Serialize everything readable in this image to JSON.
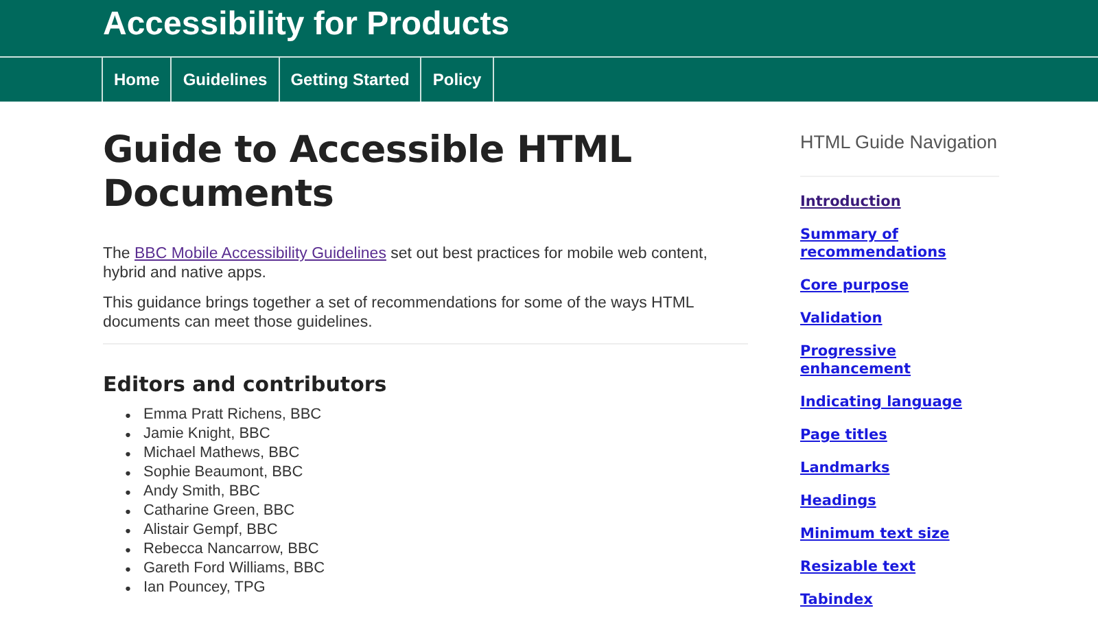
{
  "site_title": "Accessibility for Products",
  "nav": [
    {
      "label": "Home"
    },
    {
      "label": "Guidelines"
    },
    {
      "label": "Getting Started"
    },
    {
      "label": "Policy"
    }
  ],
  "page_title": "Guide to Accessible HTML Documents",
  "intro": {
    "before": "The ",
    "link": "BBC Mobile Accessibility Guidelines",
    "after": " set out best practices for mobile web content, hybrid and native apps."
  },
  "paragraph": "This guidance brings together a set of recommendations for some of the ways HTML documents can meet those guidelines.",
  "contributors_heading": "Editors and contributors",
  "contributor_marker": "•",
  "contributors": [
    "Emma Pratt Richens, BBC",
    "Jamie Knight, BBC",
    "Michael Mathews, BBC",
    "Sophie Beaumont, BBC",
    "Andy Smith, BBC",
    "Catharine Green, BBC",
    "Alistair Gempf, BBC",
    "Rebecca Nancarrow, BBC",
    "Gareth Ford Williams, BBC",
    "Ian Pouncey, TPG"
  ],
  "sidebar": {
    "title": "HTML Guide Navigation",
    "links": [
      {
        "label": "Introduction",
        "visited": true
      },
      {
        "label": "Summary of recommendations",
        "visited": false
      },
      {
        "label": "Core purpose",
        "visited": false
      },
      {
        "label": "Validation",
        "visited": false
      },
      {
        "label": "Progressive enhancement",
        "visited": false
      },
      {
        "label": "Indicating language",
        "visited": false
      },
      {
        "label": "Page titles",
        "visited": false
      },
      {
        "label": "Landmarks",
        "visited": false
      },
      {
        "label": "Headings",
        "visited": false
      },
      {
        "label": "Minimum text size",
        "visited": false
      },
      {
        "label": "Resizable text",
        "visited": false
      },
      {
        "label": "Tabindex",
        "visited": false
      }
    ]
  }
}
